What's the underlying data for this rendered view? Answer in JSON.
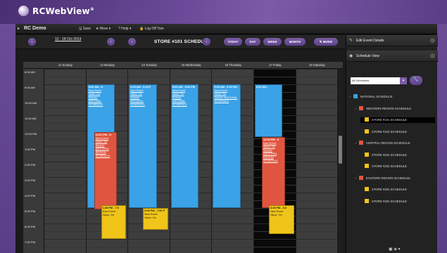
{
  "brand": {
    "name": "RCWebView",
    "reg": "®"
  },
  "menubar": {
    "title": "RC Demo",
    "items": [
      "Save",
      "More",
      "Help",
      "Log Off Tom"
    ],
    "item_icons": [
      "disk-icon",
      "star-icon",
      "help-icon",
      "lock-icon"
    ]
  },
  "toolbar": {
    "prev": "‹",
    "next": "›",
    "date_range": "12 - 18 Oct 2014",
    "schedule_prev": "‹",
    "schedule_next": "›",
    "schedule_title": "STORE #101 SCHEDULE",
    "view_buttons": [
      "TODAY",
      "DAY",
      "WEEK",
      "MONTH"
    ],
    "mode_button": "MODE"
  },
  "calendar": {
    "days": [
      "12 Sunday",
      "13 Monday",
      "14 Tuesday",
      "15 Wednesday",
      "16 Thursday",
      "17 Friday",
      "18 Saturday"
    ],
    "times": [
      "8:00 AM",
      "9:00 AM",
      "10:00 AM",
      "11:00 AM",
      "12:00 PM",
      "1:00 PM",
      "2:00 PM",
      "3:00 PM",
      "4:00 PM",
      "5:00 PM",
      "6:00 PM",
      "7:00 PM"
    ],
    "events": [
      {
        "day": 1,
        "color": "blue",
        "start": 9.0,
        "end": 17.0,
        "time": "9:00 AM - 5:",
        "lines": [
          "New Event",
          "Value: On",
          "Source:",
          "NATIONAL",
          "SCHEDULE"
        ]
      },
      {
        "day": 2,
        "color": "blue",
        "start": 9.0,
        "end": 17.0,
        "time": "9:00 AM - 5:15 P",
        "lines": [
          "New Event",
          "Value: On",
          "Source:",
          "NATIONAL",
          "SCHEDULE"
        ]
      },
      {
        "day": 3,
        "color": "blue",
        "start": 9.0,
        "end": 17.0,
        "time": "9:00 AM - 5:22 PM",
        "lines": [
          "New Event",
          "Value: On",
          "Source:",
          "NATIONAL",
          "SCHEDULE"
        ]
      },
      {
        "day": 4,
        "color": "blue",
        "start": 9.0,
        "end": 17.0,
        "time": "9:00 AM - 5:15 PM",
        "lines": [
          "New Event",
          "Value: On",
          "Source: NATIONAL",
          "SCHEDULE"
        ]
      },
      {
        "day": 5,
        "color": "blue",
        "start": 9.0,
        "end": 12.4,
        "time": "9:00 AM -",
        "lines": []
      },
      {
        "day": 1,
        "color": "red",
        "start": 12.1,
        "end": 17.1,
        "time": "12:01 PM - 5:",
        "lines": [
          "New Event",
          "Value: Off",
          "Source:",
          "WESTERN",
          "REGION",
          "SCHEDULE"
        ]
      },
      {
        "day": 5,
        "color": "red",
        "start": 12.4,
        "end": 17.0,
        "time": "12:00 PM - 5",
        "lines": [
          "New Event",
          "Value: Off",
          "Source:",
          "WESTERN",
          "REGION",
          "SCHEDULE"
        ]
      },
      {
        "day": 1,
        "color": "yellow",
        "start": 16.8,
        "end": 19.0,
        "time": "4:45 PM - 7:0",
        "lines": [
          "New Event",
          "Value: On"
        ]
      },
      {
        "day": 2,
        "color": "yellow",
        "start": 17.0,
        "end": 18.4,
        "time": "5:00 PM - 7:00 P",
        "lines": [
          "New Event",
          "Value: On"
        ]
      },
      {
        "day": 5,
        "color": "yellow",
        "start": 16.8,
        "end": 18.7,
        "time": "4:45 PM - 6:0",
        "lines": [
          "New Event",
          "Value: On"
        ]
      }
    ]
  },
  "right_panel": {
    "edit_details": "Edit Event Details",
    "schedule_view": "Schedule View",
    "schedule_select": "All Schedules",
    "tree": [
      {
        "label": "NATIONAL SCHEDULE",
        "level": 0,
        "color": "#3aa2e6",
        "toggle": "–"
      },
      {
        "label": "WESTERN REGION SCHEDULE",
        "level": 1,
        "color": "#e0553f",
        "toggle": "–"
      },
      {
        "label": "STORE #101 SCHEDULE",
        "level": 2,
        "color": "#f0c418",
        "toggle": "",
        "selected": true
      },
      {
        "label": "STORE #102 SCHEDULE",
        "level": 2,
        "color": "#f0c418",
        "toggle": ""
      },
      {
        "label": "CENTRAL REGION SCHEDULE",
        "level": 1,
        "color": "#e0553f",
        "toggle": "–"
      },
      {
        "label": "STORE #201 SCHEDULE",
        "level": 2,
        "color": "#f0c418",
        "toggle": ""
      },
      {
        "label": "STORE #202 SCHEDULE",
        "level": 2,
        "color": "#f0c418",
        "toggle": ""
      },
      {
        "label": "EASTERN REGION SCHEDULE",
        "level": 1,
        "color": "#e0553f",
        "toggle": "–"
      },
      {
        "label": "STORE #301 SCHEDULE",
        "level": 2,
        "color": "#f0c418",
        "toggle": ""
      },
      {
        "label": "STORE #302 SCHEDULE",
        "level": 2,
        "color": "#f0c418",
        "toggle": ""
      }
    ]
  }
}
